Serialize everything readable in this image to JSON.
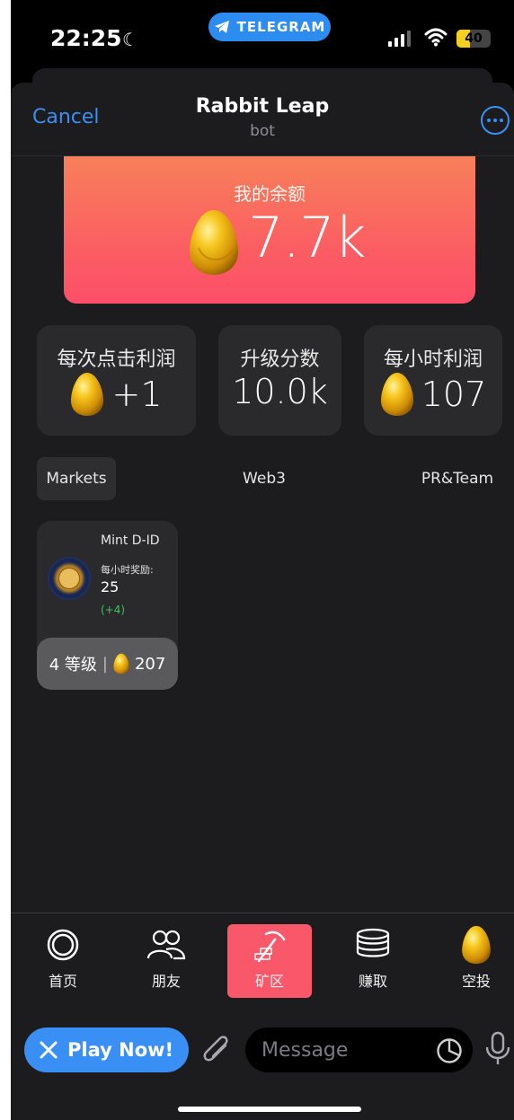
{
  "status_bar": {
    "time": "22:25",
    "telegram_label": "TELEGRAM",
    "battery": "40"
  },
  "header": {
    "cancel_label": "Cancel",
    "title": "Rabbit Leap",
    "subtitle": "bot"
  },
  "balance": {
    "label": "我的余额",
    "value": "7.7k"
  },
  "stats": [
    {
      "label": "每次点击利润",
      "value": "+1",
      "icon": "egg-icon"
    },
    {
      "label": "升级分数",
      "value": "10.0k"
    },
    {
      "label": "每小时利润",
      "value": "107",
      "icon": "egg-icon"
    }
  ],
  "categories": [
    {
      "label": "Markets",
      "active": true
    },
    {
      "label": "Web3",
      "active": false
    },
    {
      "label": "PR&Team",
      "active": false
    }
  ],
  "card": {
    "name": "Mint D-ID",
    "reward_label": "每小时奖励:",
    "reward_value": "25",
    "reward_delta": "(+4)",
    "level": "4 等级",
    "separator": "|",
    "cost": "207"
  },
  "tabs": [
    {
      "label": "首页",
      "icon": "home-ring-icon"
    },
    {
      "label": "朋友",
      "icon": "friends-icon"
    },
    {
      "label": "矿区",
      "icon": "pickaxe-icon",
      "active": true
    },
    {
      "label": "赚取",
      "icon": "coins-stack-icon"
    },
    {
      "label": "空投",
      "icon": "egg-icon"
    }
  ],
  "composer": {
    "play_label": "Play Now!",
    "message_placeholder": "Message"
  },
  "colors": {
    "accent_blue": "#3a8ff5",
    "active_tab": "#f8586a",
    "balance_gradient_top": "#f7805a",
    "balance_gradient_bottom": "#fc4f69",
    "delta_green": "#34c759"
  }
}
